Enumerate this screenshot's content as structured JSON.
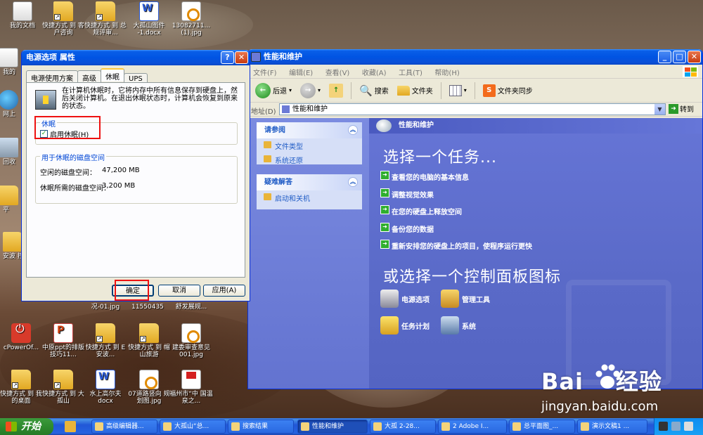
{
  "desktop": {
    "icons": [
      {
        "label": "我的文档",
        "type": "docs"
      },
      {
        "label": "快捷方式 到 客户咨询",
        "type": "folder"
      },
      {
        "label": "快捷方式 到 总规评审...",
        "type": "folder"
      },
      {
        "label": "大孤山图件 -1.docx",
        "type": "doc"
      },
      {
        "label": "13082711... (1).jpg",
        "type": "jpg"
      },
      {
        "label": "我的",
        "type": "docs"
      },
      {
        "label": "网上",
        "type": "net"
      },
      {
        "label": "回收",
        "type": "bin"
      },
      {
        "label": "平",
        "type": "folder"
      },
      {
        "label": "安波 控规",
        "type": "folder"
      },
      {
        "label": "cPowerOf...",
        "type": "power"
      },
      {
        "label": "中原ppt的排版技巧11...",
        "type": "ppt"
      },
      {
        "label": "快捷方式 到 E 安波...",
        "type": "folder"
      },
      {
        "label": "快捷方式 到 帽山旅游",
        "type": "folder"
      },
      {
        "label": "建委审查意见 001.jpg",
        "type": "jpg"
      },
      {
        "label": "快捷方式 到 我的桌面",
        "type": "folder"
      },
      {
        "label": "快捷方式 到 大孤山",
        "type": "folder"
      },
      {
        "label": "水上高尔夫 docx",
        "type": "doc"
      },
      {
        "label": "07道路竖向 规划图.jpg",
        "type": "jpg"
      },
      {
        "label": "福州市“中 国温泉之...",
        "type": "pdf"
      },
      {
        "label": "况-01.jpg",
        "type": "none"
      },
      {
        "label": "11550435",
        "type": "none"
      },
      {
        "label": "舒发展规...",
        "type": "none"
      }
    ]
  },
  "control_panel": {
    "title": "性能和维护",
    "menu": [
      "文件(F)",
      "编辑(E)",
      "查看(V)",
      "收藏(A)",
      "工具(T)",
      "帮助(H)"
    ],
    "toolbar": {
      "back": "后退",
      "search": "搜索",
      "folders": "文件夹",
      "sync": "文件夹同步"
    },
    "address_label": "地址(D)",
    "address_value": "性能和维护",
    "go": "转到",
    "see_also": {
      "title": "请参阅",
      "items": [
        "文件类型",
        "系统还原"
      ]
    },
    "troubleshoot": {
      "title": "疑难解答",
      "items": [
        "启动和关机"
      ]
    },
    "header": "性能和维护",
    "pick_task": "选择一个任务...",
    "tasks": [
      "查看您的电脑的基本信息",
      "调整视觉效果",
      "在您的硬盘上释放空间",
      "备份您的数据",
      "重新安排您的硬盘上的项目，使程序运行更快"
    ],
    "pick_icon": "或选择一个控制面板图标",
    "icons": [
      "电源选项",
      "管理工具",
      "任务计划",
      "系统"
    ]
  },
  "power_dialog": {
    "title": "电源选项 属性",
    "tabs": [
      "电源使用方案",
      "高级",
      "休眠",
      "UPS"
    ],
    "active_tab": "休眠",
    "description": "在计算机休眠时，它将内存中所有信息保存到硬盘上，然后关闭计算机。在退出休眠状态时，计算机会恢复到原来的状态。",
    "hibernate_group": "休眠",
    "enable_hibernate": "启用休眠(H)",
    "enable_hibernate_checked": true,
    "disk_group": "用于休眠的磁盘空间",
    "free_space_label": "空闲的磁盘空间：",
    "free_space_value": "47,200 MB",
    "required_label": "休眠所需的磁盘空间：",
    "required_value": "3,200 MB",
    "ok": "确定",
    "cancel": "取消",
    "apply": "应用(A)"
  },
  "taskbar": {
    "start": "开始",
    "tasks": [
      "高级编辑器...",
      "大孤山“总...",
      "搜索结果",
      "性能和维护",
      "大孤 2-28...",
      "2 Adobe I...",
      "总平面图_...",
      "演示文稿1 ..."
    ],
    "active_task": "性能和维护"
  },
  "watermark": {
    "logo": "Bai",
    "logo2": "经验",
    "url": "jingyan.baidu.com"
  }
}
